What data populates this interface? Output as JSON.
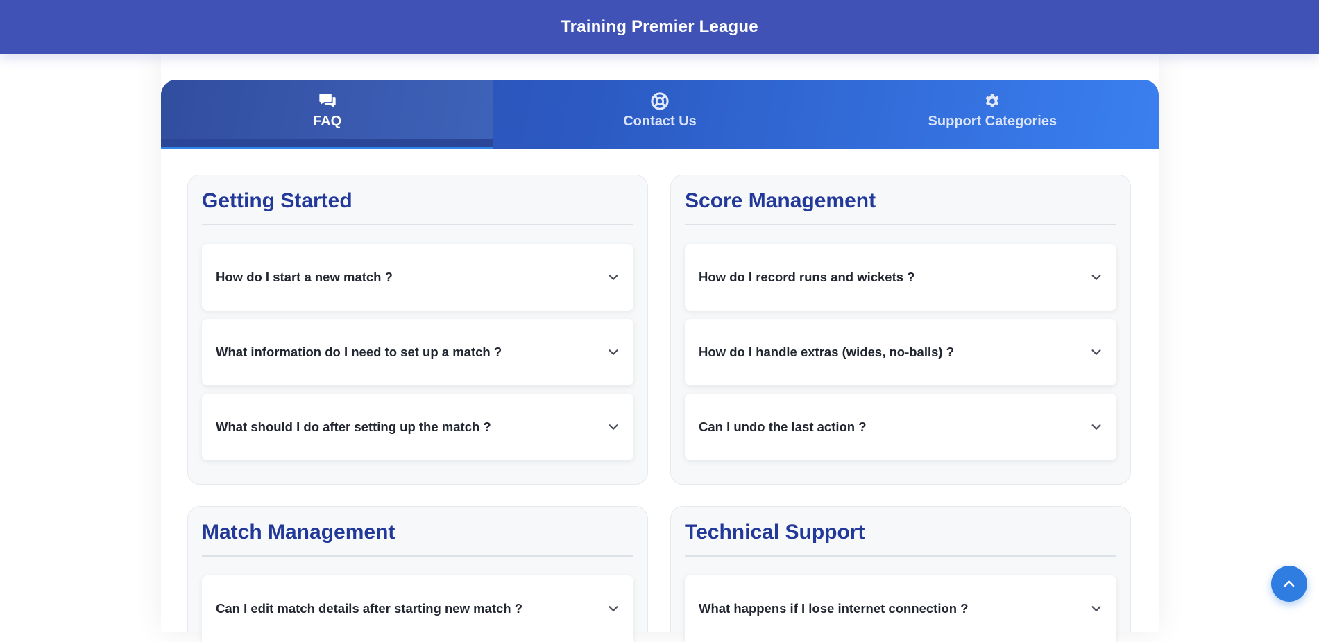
{
  "header": {
    "title": "Training Premier League"
  },
  "tabs": [
    {
      "label": "FAQ",
      "icon": "chat-icon",
      "active": true
    },
    {
      "label": "Contact Us",
      "icon": "lifebuoy-icon",
      "active": false
    },
    {
      "label": "Support Categories",
      "icon": "gear-icon",
      "active": false
    }
  ],
  "sections": [
    {
      "title": "Getting Started",
      "questions": [
        "How do I start a new match ?",
        "What information do I need to set up a match ?",
        "What should I do after setting up the match ?"
      ]
    },
    {
      "title": "Score Management",
      "questions": [
        "How do I record runs and wickets ?",
        "How do I handle extras (wides, no-balls) ?",
        "Can I undo the last action ?"
      ]
    },
    {
      "title": "Match Management",
      "questions": [
        "Can I edit match details after starting new match ?"
      ]
    },
    {
      "title": "Technical Support",
      "questions": [
        "What happens if I lose internet connection ?"
      ]
    }
  ],
  "colors": {
    "header_bg": "#4052b5",
    "section_title": "#23399a",
    "fab_bg": "#2f7de0"
  },
  "scroll_top_icon": "chevron-up-icon"
}
